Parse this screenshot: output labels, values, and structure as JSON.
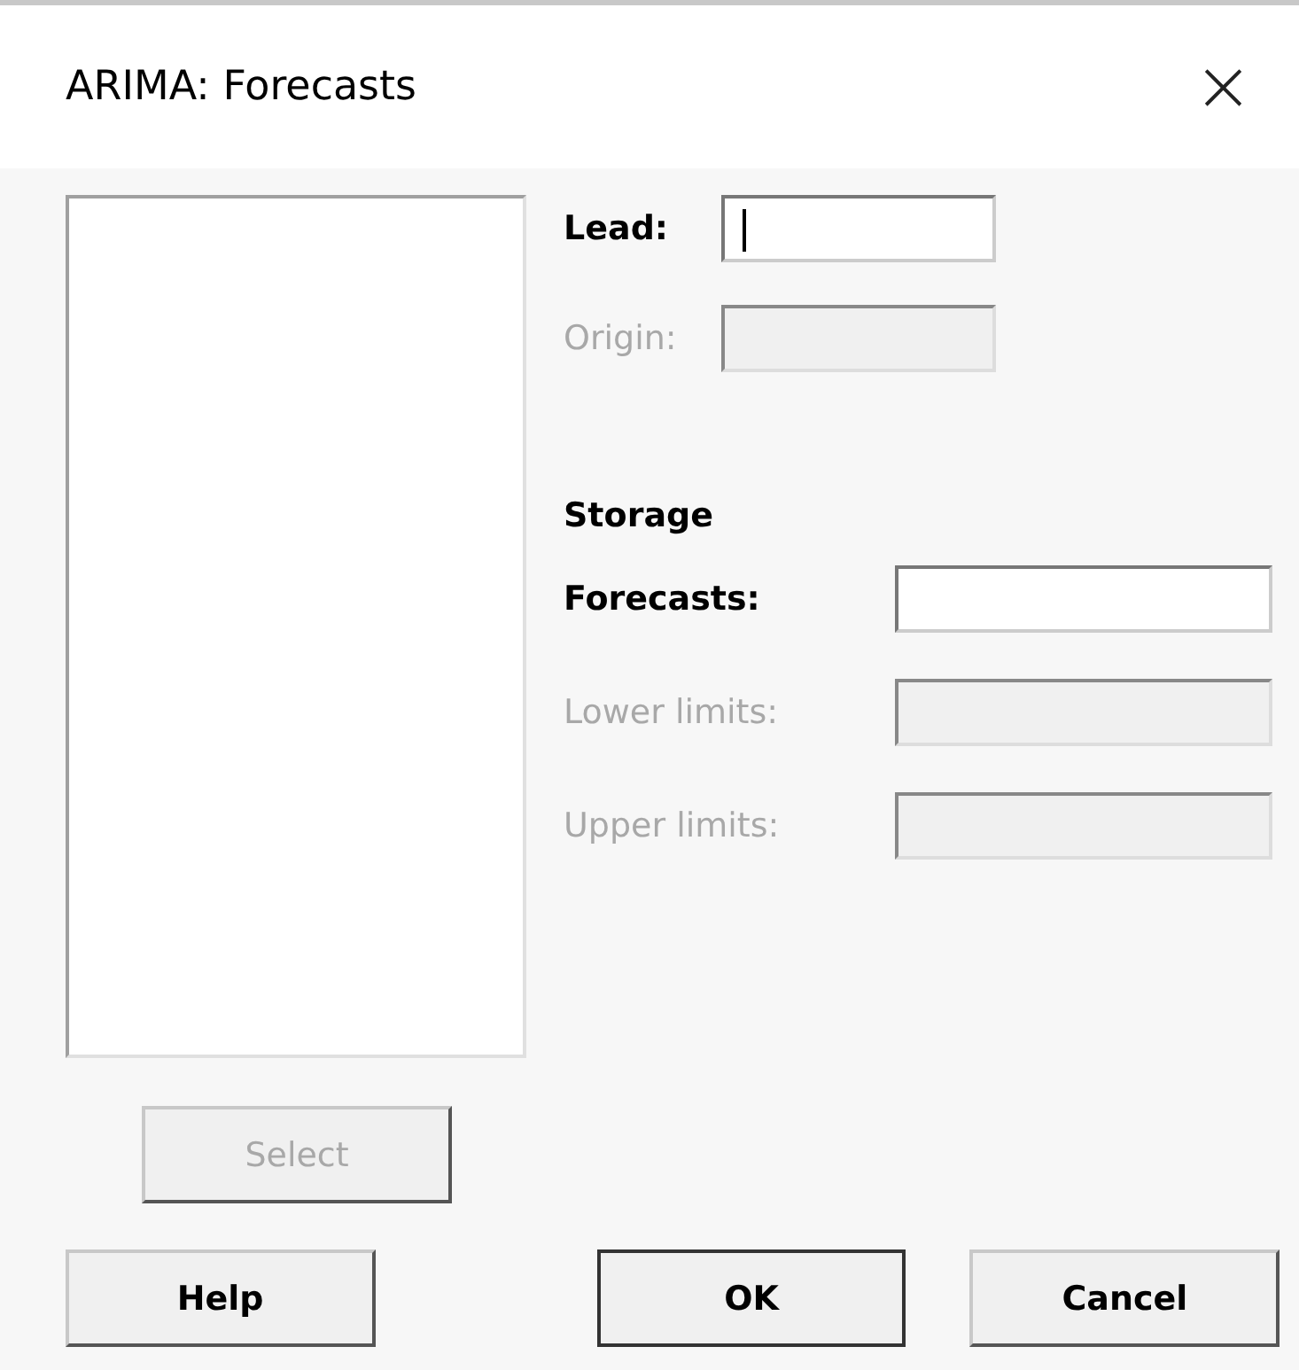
{
  "window": {
    "title": "ARIMA: Forecasts",
    "close": "×"
  },
  "fields": [
    {
      "label": "Lead:",
      "disabled": false,
      "focused": true
    },
    {
      "label": "Origin:",
      "disabled": true,
      "focused": false
    }
  ],
  "storage": {
    "heading": "Storage",
    "fields": [
      {
        "label": "Forecasts:",
        "disabled": false
      },
      {
        "label": "Lower limits:",
        "disabled": true
      },
      {
        "label": "Upper limits:",
        "disabled": true
      }
    ]
  },
  "select_button": {
    "label": "Select",
    "disabled": true
  },
  "buttons": [
    {
      "label": "Help",
      "default": false
    },
    {
      "label": "OK",
      "default": true
    },
    {
      "label": "Cancel",
      "default": false
    }
  ]
}
